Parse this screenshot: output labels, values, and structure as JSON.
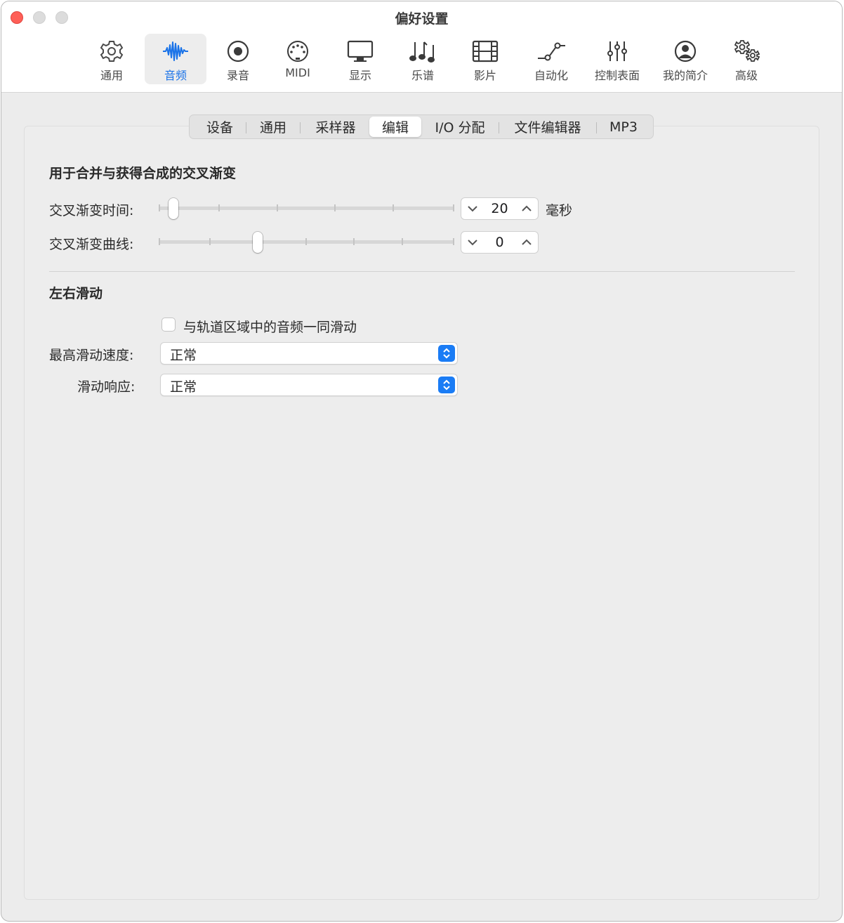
{
  "window": {
    "title": "偏好设置",
    "accent_color": "#1a73e8"
  },
  "toolbar": {
    "items": [
      {
        "label": "通用",
        "icon": "gear-icon"
      },
      {
        "label": "音频",
        "icon": "waveform-icon",
        "active": true
      },
      {
        "label": "录音",
        "icon": "record-icon"
      },
      {
        "label": "MIDI",
        "icon": "midi-connector-icon"
      },
      {
        "label": "显示",
        "icon": "monitor-icon"
      },
      {
        "label": "乐谱",
        "icon": "music-notes-icon"
      },
      {
        "label": "影片",
        "icon": "film-icon"
      },
      {
        "label": "自动化",
        "icon": "automation-curve-icon"
      },
      {
        "label": "控制表面",
        "icon": "faders-icon"
      },
      {
        "label": "我的简介",
        "icon": "person-circle-icon"
      },
      {
        "label": "高级",
        "icon": "gears-icon"
      }
    ]
  },
  "tabs": [
    "设备",
    "通用",
    "采样器",
    "编辑",
    "I/O 分配",
    "文件编辑器",
    "MP3"
  ],
  "active_tab": "编辑",
  "crossfade": {
    "title": "用于合并与获得合成的交叉渐变",
    "time_label": "交叉渐变时间:",
    "time_value": "20",
    "time_unit": "毫秒",
    "curve_label": "交叉渐变曲线:",
    "curve_value": "0"
  },
  "scrub": {
    "title": "左右滑动",
    "checkbox_label": "与轨道区域中的音频一同滑动",
    "checkbox_checked": false,
    "max_speed_label": "最高滑动速度:",
    "max_speed_value": "正常",
    "response_label": "滑动响应:",
    "response_value": "正常"
  }
}
